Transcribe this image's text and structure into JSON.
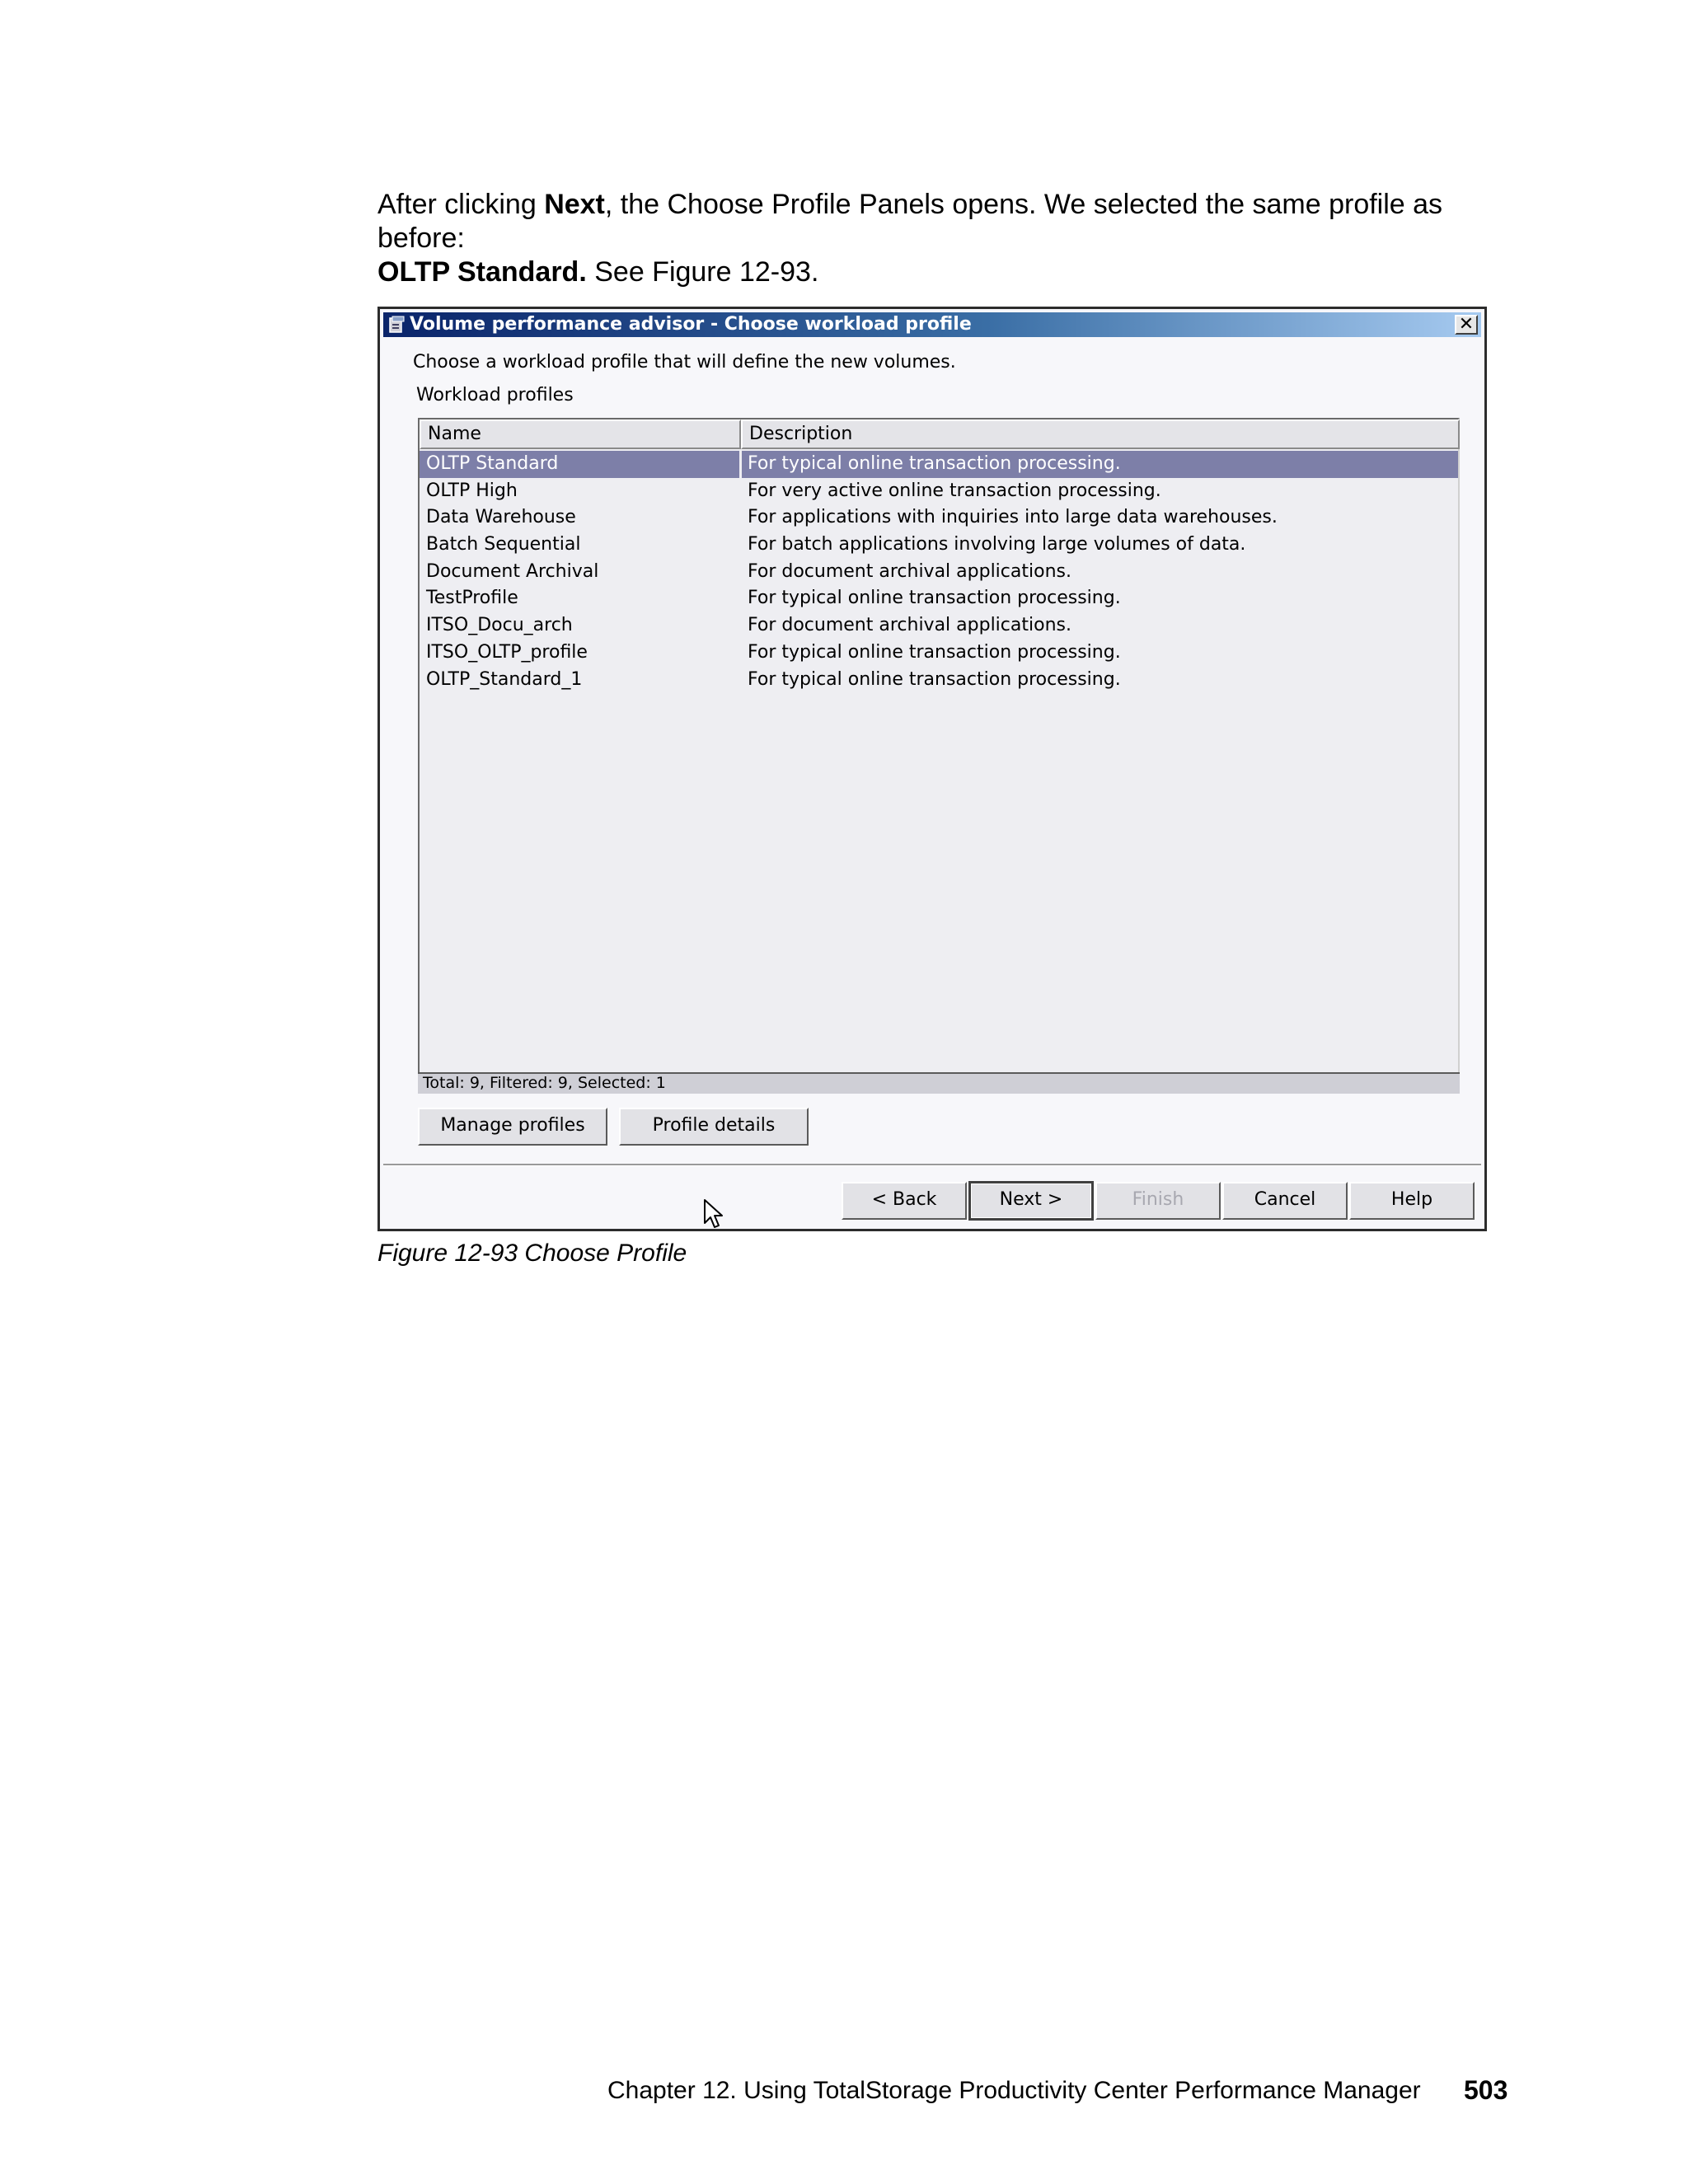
{
  "intro": {
    "p1": "After clicking ",
    "b1": "Next",
    "p2": ", the Choose Profile Panels opens. We selected the same profile as before: ",
    "b2": "OLTP Standard.",
    "p3": " See Figure 12-93."
  },
  "dialog": {
    "title": "Volume performance advisor - Choose workload profile",
    "close_glyph": "✕",
    "instruction": "Choose a workload profile that will define the new volumes.",
    "group_label": "Workload profiles",
    "columns": [
      "Name",
      "Description"
    ],
    "rows": [
      {
        "name": "OLTP Standard",
        "desc": "For typical online transaction processing."
      },
      {
        "name": "OLTP High",
        "desc": "For very active online transaction processing."
      },
      {
        "name": "Data Warehouse",
        "desc": "For applications with inquiries into large data warehouses."
      },
      {
        "name": "Batch Sequential",
        "desc": "For batch applications involving large volumes of data."
      },
      {
        "name": "Document Archival",
        "desc": "For document archival applications."
      },
      {
        "name": "TestProfile",
        "desc": "For typical online transaction processing."
      },
      {
        "name": "ITSO_Docu_arch",
        "desc": "For document archival applications."
      },
      {
        "name": "ITSO_OLTP_profile",
        "desc": "For typical online transaction processing."
      },
      {
        "name": "OLTP_Standard_1",
        "desc": "For typical online transaction processing."
      }
    ],
    "selected_index": 0,
    "status": "Total: 9, Filtered: 9, Selected: 1",
    "buttons": {
      "manage": "Manage profiles",
      "details": "Profile details",
      "back": "< Back",
      "next": "Next >",
      "finish": "Finish",
      "cancel": "Cancel",
      "help": "Help"
    }
  },
  "caption": "Figure 12-93   Choose Profile",
  "footer": {
    "chapter": "Chapter 12. Using TotalStorage Productivity Center Performance Manager",
    "page": "503"
  }
}
